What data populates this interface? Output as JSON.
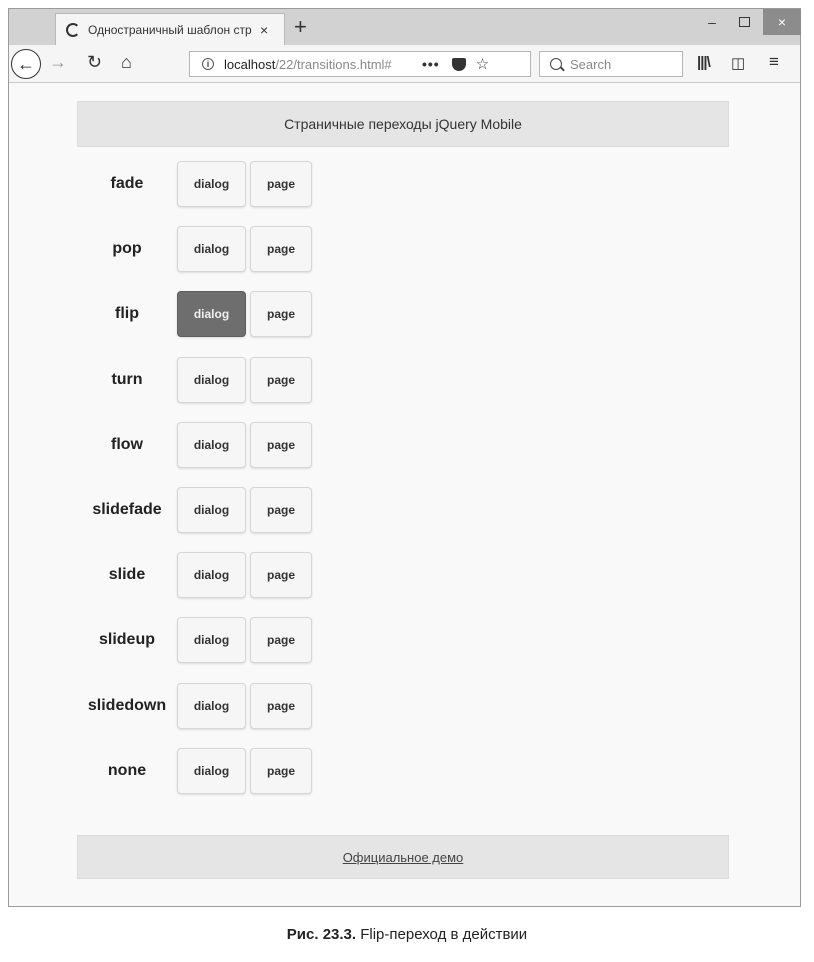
{
  "browser": {
    "tab_title": "Одностраничный шаблон стр",
    "tab_close": "×",
    "new_tab": "+",
    "url_host": "localhost",
    "url_path": "/22/transitions.html#",
    "url_more": "•••",
    "search_placeholder": "Search",
    "window_minimize": "–",
    "window_close": "×"
  },
  "page": {
    "header_title": "Страничные переходы jQuery Mobile",
    "footer_link": "Официальное демо",
    "dialog_label": "dialog",
    "page_label": "page",
    "active_transition": "flip",
    "transitions": [
      {
        "name": "fade",
        "dialog": "dialog",
        "page": "page"
      },
      {
        "name": "pop",
        "dialog": "dialog",
        "page": "page"
      },
      {
        "name": "flip",
        "dialog": "dialog",
        "page": "page"
      },
      {
        "name": "turn",
        "dialog": "dialog",
        "page": "page"
      },
      {
        "name": "flow",
        "dialog": "dialog",
        "page": "page"
      },
      {
        "name": "slidefade",
        "dialog": "dialog",
        "page": "page"
      },
      {
        "name": "slide",
        "dialog": "dialog",
        "page": "page"
      },
      {
        "name": "slideup",
        "dialog": "dialog",
        "page": "page"
      },
      {
        "name": "slidedown",
        "dialog": "dialog",
        "page": "page"
      },
      {
        "name": "none",
        "dialog": "dialog",
        "page": "page"
      }
    ]
  },
  "caption": {
    "label": "Рис. 23.3.",
    "text": "Flip-переход в действии"
  }
}
